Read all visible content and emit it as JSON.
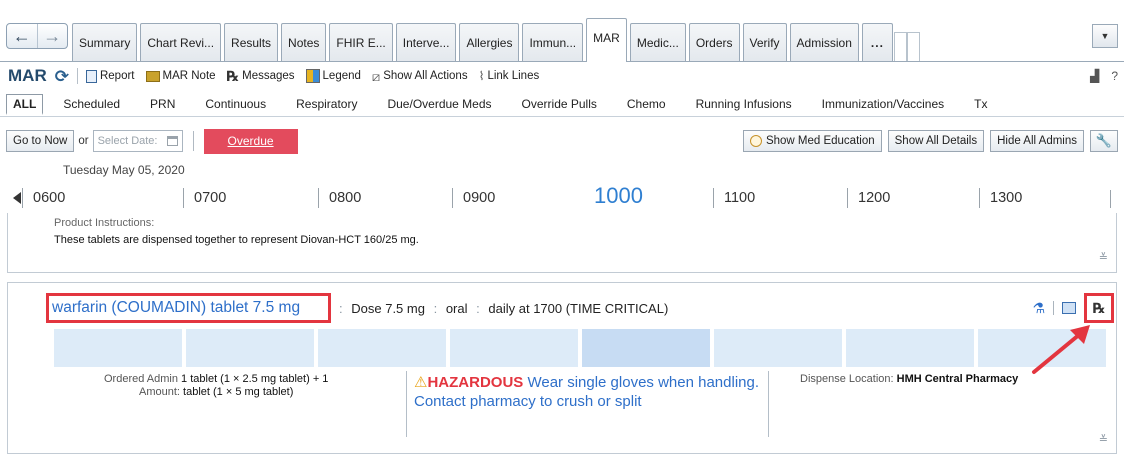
{
  "window": {
    "nav_back": "←",
    "nav_forward": "→",
    "tabs": [
      "Summary",
      "Chart Revi...",
      "Results",
      "Notes",
      "FHIR E...",
      "Interve...",
      "Allergies",
      "Immun...",
      "MAR",
      "Medic...",
      "Orders",
      "Verify",
      "Admission",
      "..."
    ],
    "active_tab": "MAR"
  },
  "toolbar": {
    "title": "MAR",
    "report": "Report",
    "mar_note": "MAR Note",
    "messages": "Messages",
    "legend": "Legend",
    "show_all_actions": "Show All Actions",
    "link_lines": "Link Lines"
  },
  "filters": [
    "ALL",
    "Scheduled",
    "PRN",
    "Continuous",
    "Respiratory",
    "Due/Overdue Meds",
    "Override Pulls",
    "Chemo",
    "Running Infusions",
    "Immunization/Vaccines",
    "Tx"
  ],
  "actions": {
    "go_to_now": "Go to Now",
    "or": "or",
    "select_date": "Select Date:",
    "overdue": "Overdue",
    "show_med_education": "Show Med Education",
    "show_all_details": "Show All Details",
    "hide_all_admins": "Hide All Admins"
  },
  "timeline": {
    "date": "Tuesday May 05, 2020",
    "hours": [
      "0600",
      "0700",
      "0800",
      "0900",
      "1000",
      "1100",
      "1200",
      "1300"
    ],
    "current_hour": "1000"
  },
  "previous_med": {
    "instructions_label": "Product Instructions:",
    "instructions_text": "These tablets are dispensed together to represent Diovan-HCT 160/25 mg."
  },
  "medication": {
    "name": "warfarin (COUMADIN) tablet 7.5 mg",
    "dose": "Dose 7.5 mg",
    "route": "oral",
    "schedule": "daily at 1700 (TIME CRITICAL)",
    "ordered_admin_label": "Ordered Admin",
    "ordered_admin_value": "1 tablet (1 × 2.5 mg tablet) + 1",
    "amount_label": "Amount:",
    "amount_value": "tablet (1 × 5 mg tablet)",
    "hazard_word": "HAZARDOUS",
    "hazard_text": "Wear single gloves when handling. Contact pharmacy to crush or split",
    "dispense_label": "Dispense Location:",
    "dispense_value": "HMH Central Pharmacy"
  },
  "colors": {
    "accent_blue": "#2e6fc9",
    "overdue_red": "#e34b5d",
    "highlight_red": "#e3353f",
    "admin_cell": "#ddebf8"
  }
}
